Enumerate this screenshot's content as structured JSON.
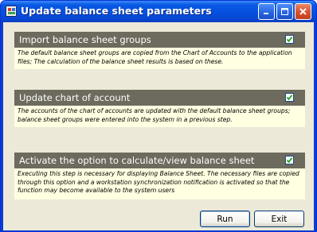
{
  "window": {
    "title": "Update balance sheet parameters"
  },
  "sections": [
    {
      "title": "Import balance sheet groups",
      "checked": true,
      "description": "The default balance sheet groups are copied from the Chart of Accounts to the application files; The calculation of the balance sheet results is based on these."
    },
    {
      "title": "Update chart of account",
      "checked": true,
      "description": "The accounts of the chart of accounts are updated with the default balance sheet groups; balance sheet groups were entered into the system in a previous step."
    },
    {
      "title": "Activate the option to calculate/view balance sheet",
      "checked": true,
      "description": "Executing this step is necessary for displaying Balance Sheet. The necessary files are copied through this option and a workstation synchronization notification is activated so that the function may become available to the system users"
    }
  ],
  "buttons": {
    "run": "Run",
    "exit": "Exit"
  },
  "colors": {
    "titlebar": "#0550e0",
    "section_header": "#6d6a5e",
    "section_body": "#ffffe1",
    "client": "#ece9d8"
  },
  "icons": [
    "app-icon",
    "minimize-icon",
    "maximize-icon",
    "close-icon",
    "checkmark-icon"
  ]
}
